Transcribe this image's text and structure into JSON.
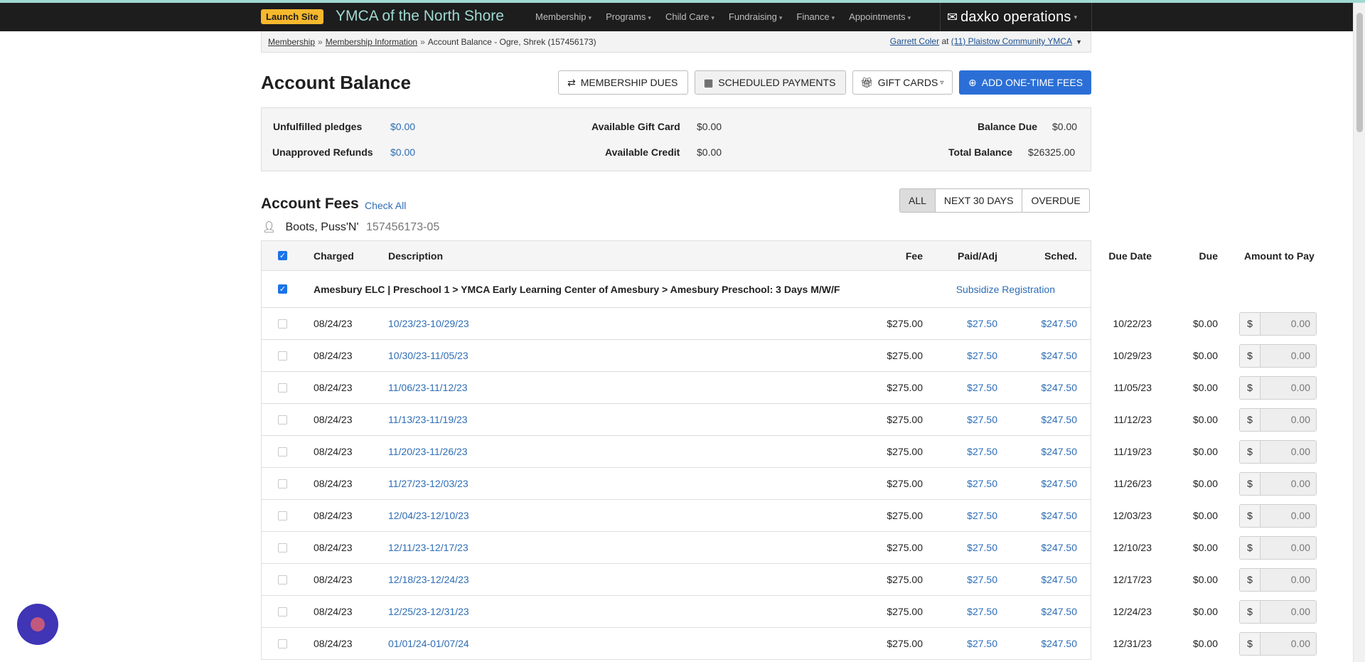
{
  "navbar": {
    "launch_label": "Launch Site",
    "org_title": "YMCA of the North Shore",
    "menu": [
      {
        "label": "Membership"
      },
      {
        "label": "Programs"
      },
      {
        "label": "Child Care"
      },
      {
        "label": "Fundraising"
      },
      {
        "label": "Finance"
      },
      {
        "label": "Appointments"
      }
    ],
    "brand": "daxko operations",
    "accent_color": "#9fd9d2",
    "launch_color": "#f6b82d"
  },
  "breadcrumb": {
    "items": [
      "Membership",
      "Membership Information"
    ],
    "current": "Account Balance - Ogre, Shrek (157456173)",
    "separator": "»"
  },
  "user": {
    "name": "Garrett Coler",
    "at": "at",
    "location": "(11) Plaistow Community YMCA"
  },
  "page": {
    "title": "Account Balance"
  },
  "actions": {
    "membership_dues": "MEMBERSHIP DUES",
    "scheduled_payments": "SCHEDULED PAYMENTS",
    "gift_cards": "GIFT CARDS",
    "add_fees": "ADD ONE-TIME FEES",
    "primary_color": "#2b6fd6"
  },
  "summary": {
    "unfulfilled_pledges_label": "Unfulfilled pledges",
    "unfulfilled_pledges_value": "$0.00",
    "unapproved_refunds_label": "Unapproved Refunds",
    "unapproved_refunds_value": "$0.00",
    "available_gift_card_label": "Available Gift Card",
    "available_gift_card_value": "$0.00",
    "available_credit_label": "Available Credit",
    "available_credit_value": "$0.00",
    "balance_due_label": "Balance Due",
    "balance_due_value": "$0.00",
    "total_balance_label": "Total Balance",
    "total_balance_value": "$26325.00"
  },
  "fees": {
    "title": "Account Fees",
    "check_all": "Check All",
    "filters": [
      "ALL",
      "NEXT 30 DAYS",
      "OVERDUE"
    ],
    "active_filter": "ALL",
    "member_name": "Boots, Puss'N'",
    "member_id": "157456173-05",
    "columns": [
      "Charged",
      "Description",
      "Fee",
      "Paid/Adj",
      "Sched.",
      "Due Date",
      "Due",
      "Amount to Pay"
    ],
    "group_title": "Amesbury ELC | Preschool 1 > YMCA Early Learning Center of Amesbury > Amesbury Preschool: 3 Days M/W/F",
    "group_action": "Subsidize Registration",
    "currency_prefix": "$",
    "amount_placeholder": "0.00",
    "rows": [
      {
        "charged": "08/24/23",
        "description": "10/23/23-10/29/23",
        "fee": "$275.00",
        "paid": "$27.50",
        "sched": "$247.50",
        "due_date": "10/22/23",
        "due": "$0.00"
      },
      {
        "charged": "08/24/23",
        "description": "10/30/23-11/05/23",
        "fee": "$275.00",
        "paid": "$27.50",
        "sched": "$247.50",
        "due_date": "10/29/23",
        "due": "$0.00"
      },
      {
        "charged": "08/24/23",
        "description": "11/06/23-11/12/23",
        "fee": "$275.00",
        "paid": "$27.50",
        "sched": "$247.50",
        "due_date": "11/05/23",
        "due": "$0.00"
      },
      {
        "charged": "08/24/23",
        "description": "11/13/23-11/19/23",
        "fee": "$275.00",
        "paid": "$27.50",
        "sched": "$247.50",
        "due_date": "11/12/23",
        "due": "$0.00"
      },
      {
        "charged": "08/24/23",
        "description": "11/20/23-11/26/23",
        "fee": "$275.00",
        "paid": "$27.50",
        "sched": "$247.50",
        "due_date": "11/19/23",
        "due": "$0.00"
      },
      {
        "charged": "08/24/23",
        "description": "11/27/23-12/03/23",
        "fee": "$275.00",
        "paid": "$27.50",
        "sched": "$247.50",
        "due_date": "11/26/23",
        "due": "$0.00"
      },
      {
        "charged": "08/24/23",
        "description": "12/04/23-12/10/23",
        "fee": "$275.00",
        "paid": "$27.50",
        "sched": "$247.50",
        "due_date": "12/03/23",
        "due": "$0.00"
      },
      {
        "charged": "08/24/23",
        "description": "12/11/23-12/17/23",
        "fee": "$275.00",
        "paid": "$27.50",
        "sched": "$247.50",
        "due_date": "12/10/23",
        "due": "$0.00"
      },
      {
        "charged": "08/24/23",
        "description": "12/18/23-12/24/23",
        "fee": "$275.00",
        "paid": "$27.50",
        "sched": "$247.50",
        "due_date": "12/17/23",
        "due": "$0.00"
      },
      {
        "charged": "08/24/23",
        "description": "12/25/23-12/31/23",
        "fee": "$275.00",
        "paid": "$27.50",
        "sched": "$247.50",
        "due_date": "12/24/23",
        "due": "$0.00"
      },
      {
        "charged": "08/24/23",
        "description": "01/01/24-01/07/24",
        "fee": "$275.00",
        "paid": "$27.50",
        "sched": "$247.50",
        "due_date": "12/31/23",
        "due": "$0.00"
      }
    ]
  }
}
